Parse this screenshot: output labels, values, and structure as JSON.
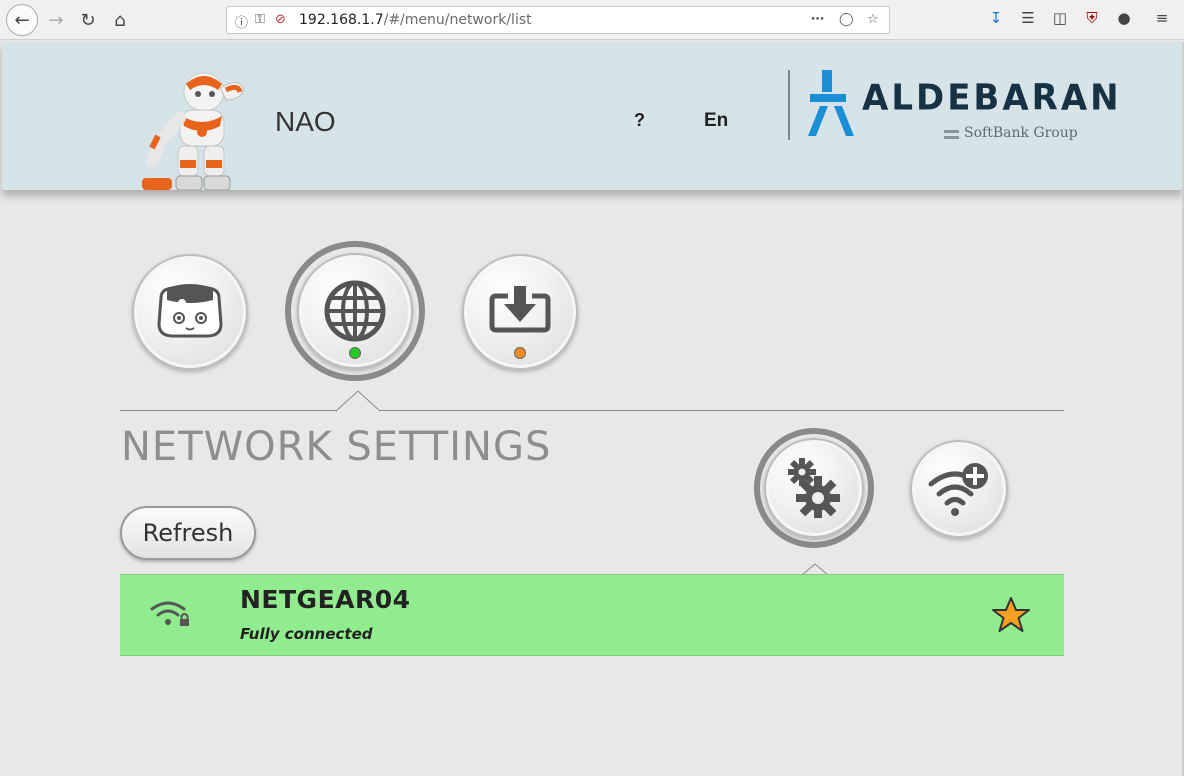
{
  "browser": {
    "url_host": "192.168.1.7",
    "url_path": "/#/menu/network/list"
  },
  "header": {
    "robot_name": "NAO",
    "help_label": "?",
    "language_label": "En",
    "brand_name": "ALDEBARAN",
    "brand_sub": "SoftBank Group",
    "brand_color": "#173244",
    "brand_accent": "#1a8fd6"
  },
  "tabs": [
    {
      "name": "robot",
      "icon": "robot-head-icon",
      "status_color": null,
      "active": false
    },
    {
      "name": "network",
      "icon": "globe-icon",
      "status_color": "#22cc22",
      "active": true
    },
    {
      "name": "update",
      "icon": "download-icon",
      "status_color": "#f08a24",
      "active": false
    }
  ],
  "network": {
    "title": "NETWORK SETTINGS",
    "refresh_label": "Refresh",
    "actions": [
      {
        "icon": "gears-icon",
        "active": true
      },
      {
        "icon": "wifi-add-icon",
        "active": false
      }
    ],
    "list": [
      {
        "ssid": "NETGEAR04",
        "status": "Fully connected",
        "secured": true,
        "favorite": true,
        "row_color": "#90ec8e"
      }
    ]
  }
}
